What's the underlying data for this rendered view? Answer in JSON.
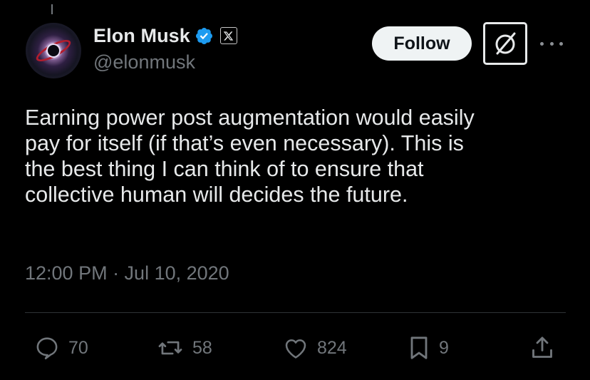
{
  "tweet": {
    "author": {
      "display_name": "Elon Musk",
      "handle": "@elonmusk",
      "verified": true,
      "affiliate_badge": "x-logo-icon"
    },
    "follow_label": "Follow",
    "text": "Earning power post augmentation would easily\npay for itself (if that’s even necessary). This is\nthe best thing I can think of to ensure that\ncollective human will decides the future.",
    "timestamp": "12:00 PM · Jul 10, 2020",
    "metrics": {
      "replies": "70",
      "reposts": "58",
      "likes": "824",
      "bookmarks": "9"
    }
  },
  "colors": {
    "background": "#000000",
    "primary_text": "#e7e9ea",
    "secondary_text": "#71767b",
    "verified_blue": "#1d9bf0",
    "divider": "#2f3336"
  }
}
